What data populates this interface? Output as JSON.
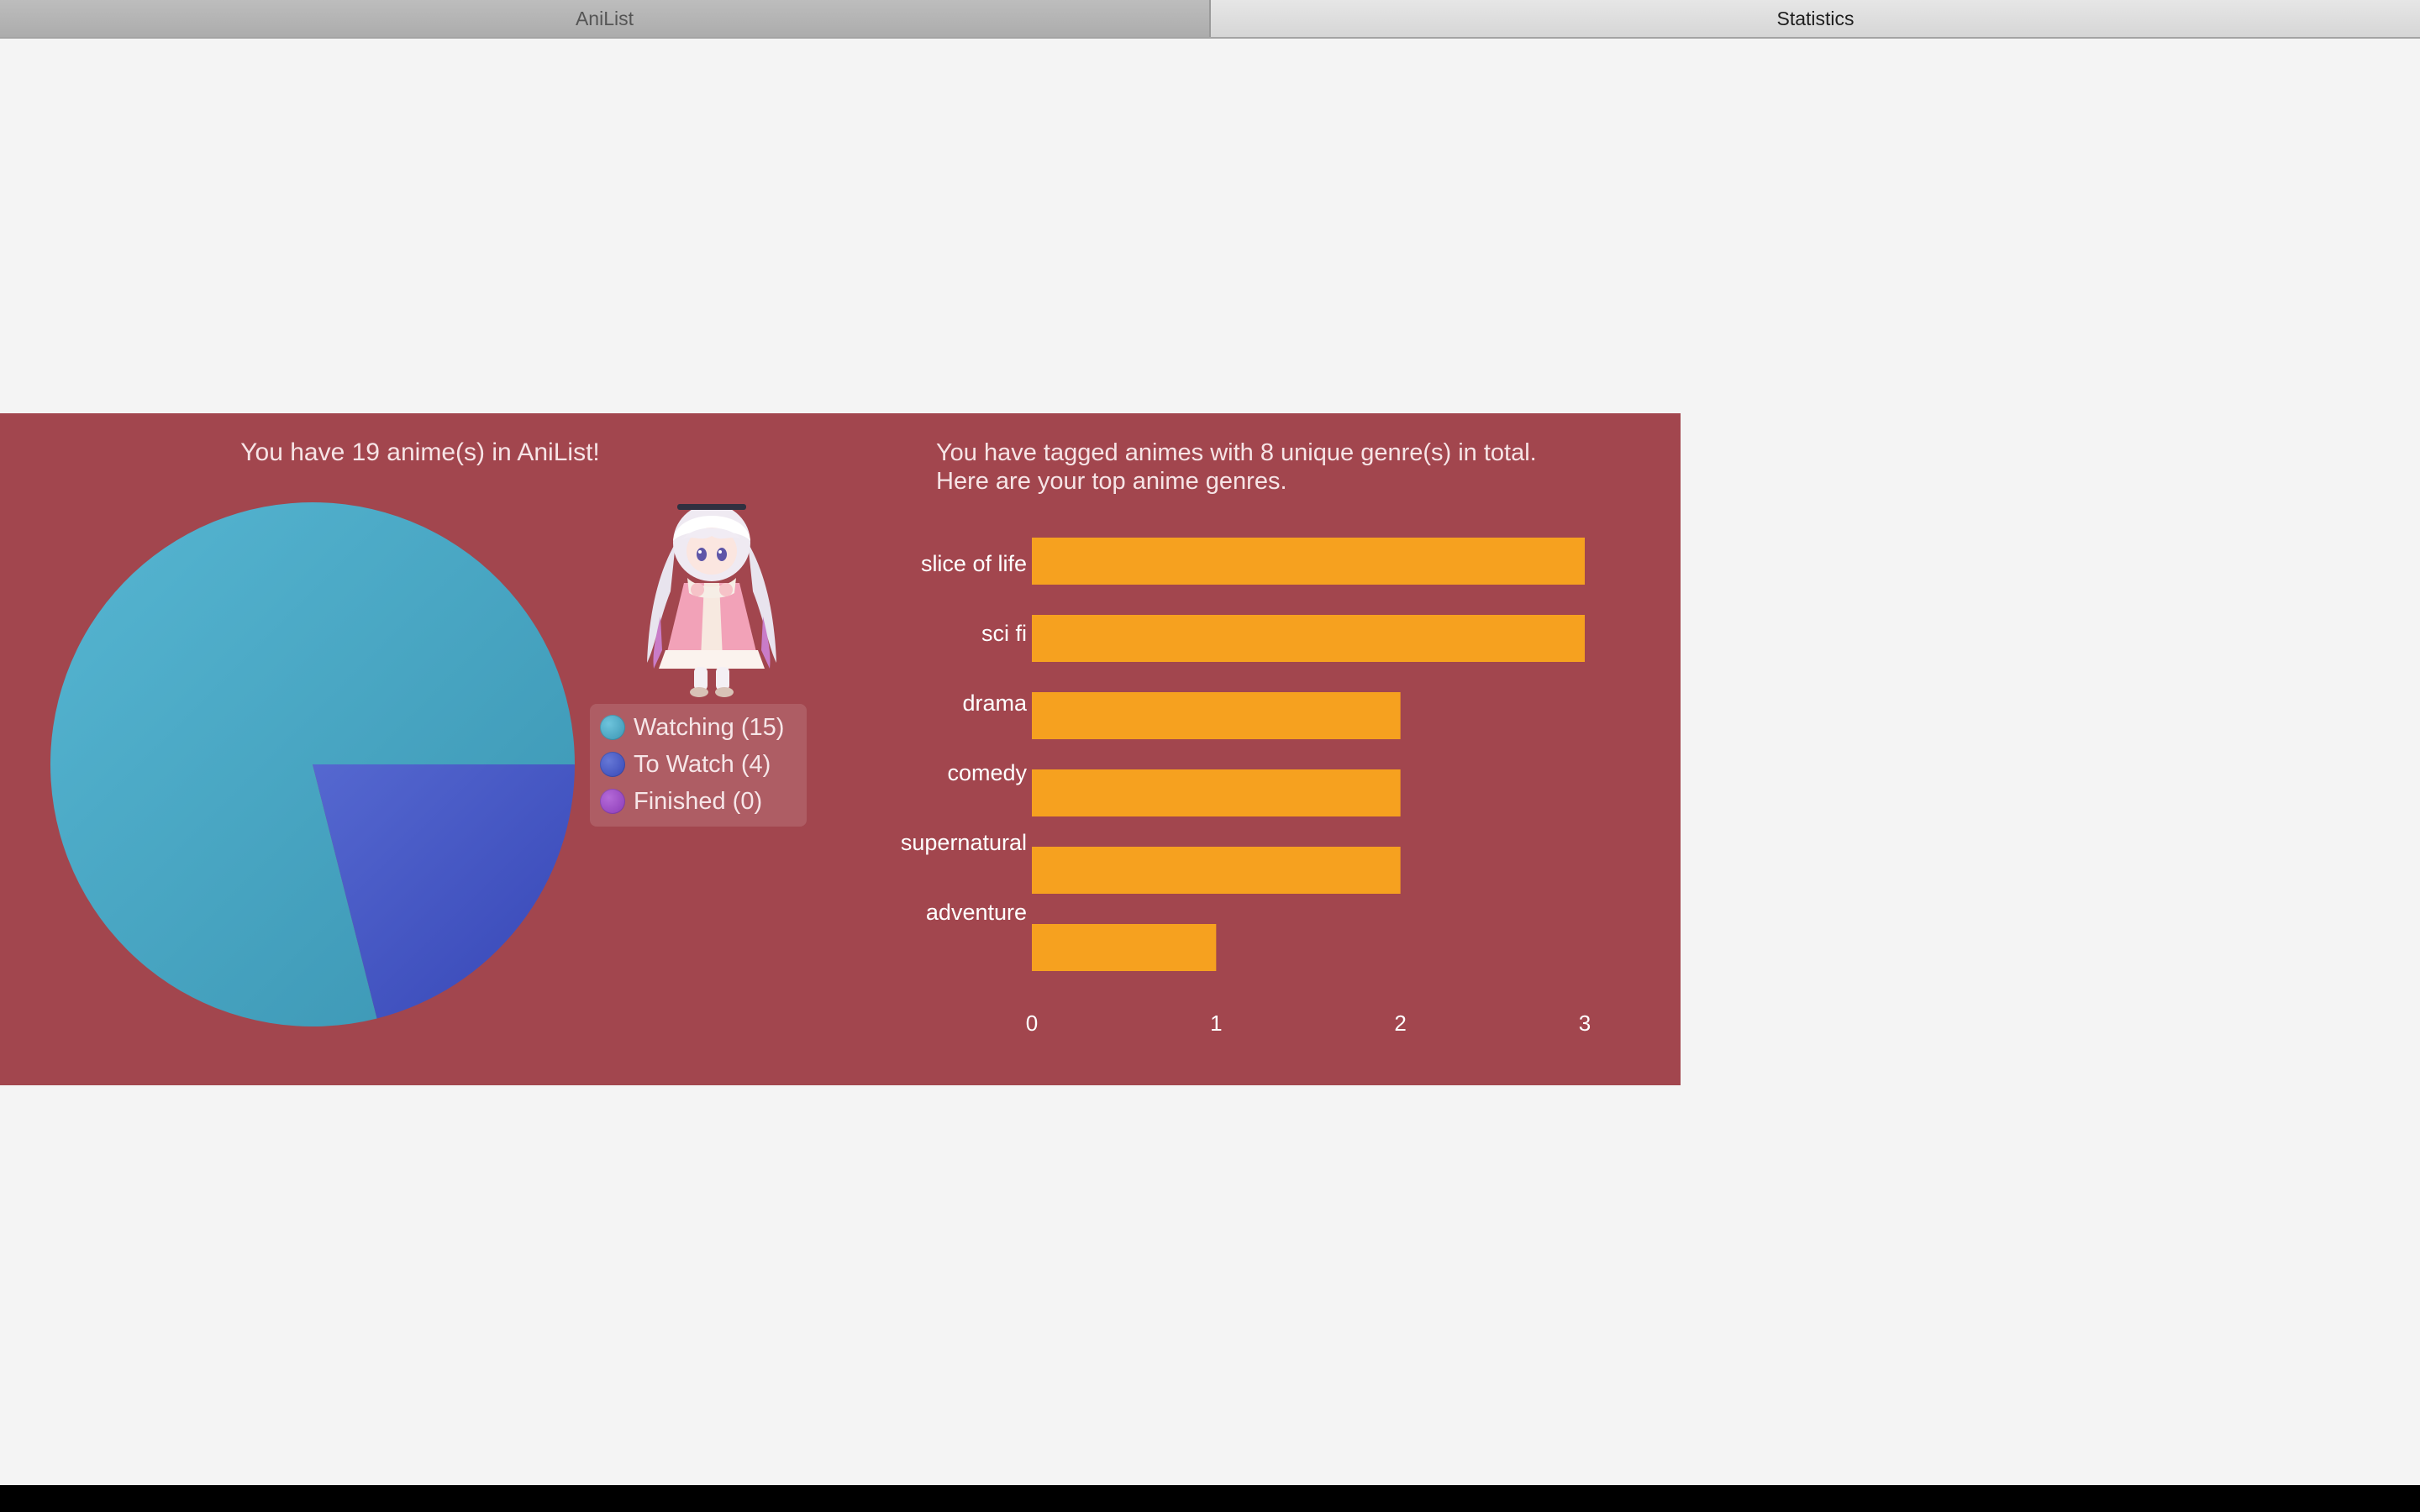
{
  "tabs": [
    {
      "label": "AniList",
      "active": false
    },
    {
      "label": "Statistics",
      "active": true
    }
  ],
  "pie_title": "You have 19 anime(s) in AniList!",
  "bar_title_line1": "You have tagged animes with 8 unique genre(s) in total.",
  "bar_title_line2": "Here are your top anime genres.",
  "legend": [
    {
      "label": "Watching (15)",
      "color": "#4aa6c3"
    },
    {
      "label": "To Watch (4)",
      "color": "#4455c0"
    },
    {
      "label": "Finished (0)",
      "color": "#9a46c4"
    }
  ],
  "colors": {
    "panel": "#a2464e",
    "bar": "#f6a11f",
    "background": "#f4f4f4"
  },
  "chart_data": [
    {
      "type": "pie",
      "title": "You have 19 anime(s) in AniList!",
      "categories": [
        "Watching",
        "To Watch",
        "Finished"
      ],
      "values": [
        15,
        4,
        0
      ],
      "legend": "right"
    },
    {
      "type": "bar",
      "orientation": "horizontal",
      "title": "You have tagged animes with 8 unique genre(s) in total. Here are your top anime genres.",
      "categories": [
        "slice of life",
        "sci fi",
        "drama",
        "comedy",
        "supernatural",
        "adventure"
      ],
      "values": [
        3,
        3,
        2,
        2,
        2,
        1
      ],
      "xlim": [
        0,
        3
      ],
      "xticks": [
        "0",
        "1",
        "2",
        "3"
      ],
      "grid": false
    }
  ]
}
